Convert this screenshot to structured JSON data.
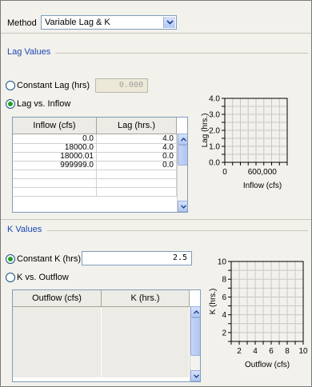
{
  "method": {
    "label": "Method",
    "selected": "Variable Lag & K"
  },
  "lag": {
    "section_title": "Lag Values",
    "constant_label": "Constant Lag (hrs)",
    "constant_value": "0.000",
    "vs_label": "Lag vs. Inflow",
    "table": {
      "headers": [
        "Inflow (cfs)",
        "Lag (hrs.)"
      ],
      "rows": [
        [
          "0.0",
          "4.0"
        ],
        [
          "18000.0",
          "4.0"
        ],
        [
          "18000.01",
          "0.0"
        ],
        [
          "999999.0",
          "0.0"
        ],
        [
          "",
          ""
        ],
        [
          "",
          ""
        ],
        [
          "",
          ""
        ]
      ]
    }
  },
  "k": {
    "section_title": "K Values",
    "constant_label": "Constant K (hrs)",
    "constant_value": "2.5",
    "vs_label": "K vs. Outflow",
    "table": {
      "headers": [
        "Outflow (cfs)",
        "K (hrs.)"
      ],
      "rows": [
        [
          "",
          ""
        ],
        [
          "",
          ""
        ],
        [
          "",
          ""
        ],
        [
          "",
          ""
        ],
        [
          "",
          ""
        ],
        [
          "",
          ""
        ],
        [
          "",
          ""
        ],
        [
          "",
          ""
        ]
      ]
    }
  },
  "chart_data": [
    {
      "type": "line",
      "xlabel": "Inflow (cfs)",
      "ylabel": "Lag (hrs.)",
      "x_tick_labels": [
        "0",
        "600,000"
      ],
      "y_tick_labels": [
        "0.0",
        "1.0",
        "2.0",
        "3.0",
        "4.0"
      ],
      "xlim": [
        0,
        1000000
      ],
      "ylim": [
        0,
        4
      ],
      "grid": true,
      "series": []
    },
    {
      "type": "line",
      "xlabel": "Outflow (cfs)",
      "ylabel": "K (hrs.)",
      "x_tick_labels": [
        "2",
        "4",
        "6",
        "8",
        "10"
      ],
      "y_tick_labels": [
        "2",
        "4",
        "6",
        "8",
        "10"
      ],
      "xlim": [
        1,
        10
      ],
      "ylim": [
        1,
        10
      ],
      "grid": true,
      "series": []
    }
  ]
}
